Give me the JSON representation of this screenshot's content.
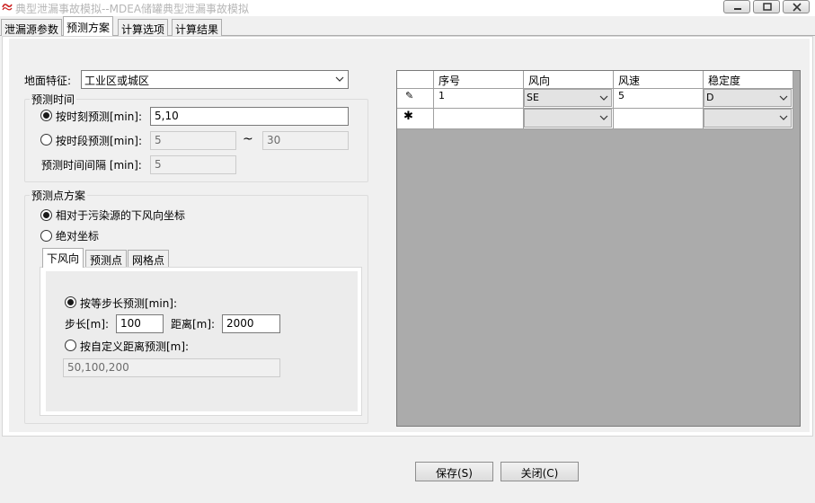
{
  "window": {
    "title": "典型泄漏事故模拟--MDEA储罐典型泄漏事故模拟"
  },
  "tabs": [
    {
      "label": "泄漏源参数"
    },
    {
      "label": "预测方案"
    },
    {
      "label": "计算选项"
    },
    {
      "label": "计算结果"
    }
  ],
  "terrain": {
    "label": "地面特征:",
    "value": "工业区或城区"
  },
  "prediction_time": {
    "group_label": "预测时间",
    "by_moment_label": "按时刻预测[min]:",
    "by_moment_value": "5,10",
    "by_period_label": "按时段预测[min]:",
    "period_from": "5",
    "period_tilde": "~",
    "period_to": "30",
    "interval_label": "预测时间间隔 [min]:",
    "interval_value": "5"
  },
  "prediction_points": {
    "group_label": "预测点方案",
    "relative_label": "相对于污染源的下风向坐标",
    "absolute_label": "绝对坐标",
    "subtabs": [
      {
        "label": "下风向"
      },
      {
        "label": "预测点"
      },
      {
        "label": "网格点"
      }
    ],
    "equal_step_label": "按等步长预测[min]:",
    "step_label": "步长[m]:",
    "step_value": "100",
    "distance_label": "距离[m]:",
    "distance_value": "2000",
    "custom_label": "按自定义距离预测[m]:",
    "custom_value": "50,100,200"
  },
  "grid": {
    "columns": [
      "序号",
      "风向",
      "风速",
      "稳定度"
    ],
    "rows": [
      {
        "marker": "✎",
        "no": "1",
        "direction": "SE",
        "speed": "5",
        "stability": "D"
      },
      {
        "marker": "✱",
        "no": "",
        "direction": "",
        "speed": "",
        "stability": ""
      }
    ]
  },
  "buttons": {
    "save": "保存(S)",
    "close": "关闭(C)"
  },
  "colors": {
    "grid_background": "#ababab",
    "title_text": "#b6b6b6"
  }
}
